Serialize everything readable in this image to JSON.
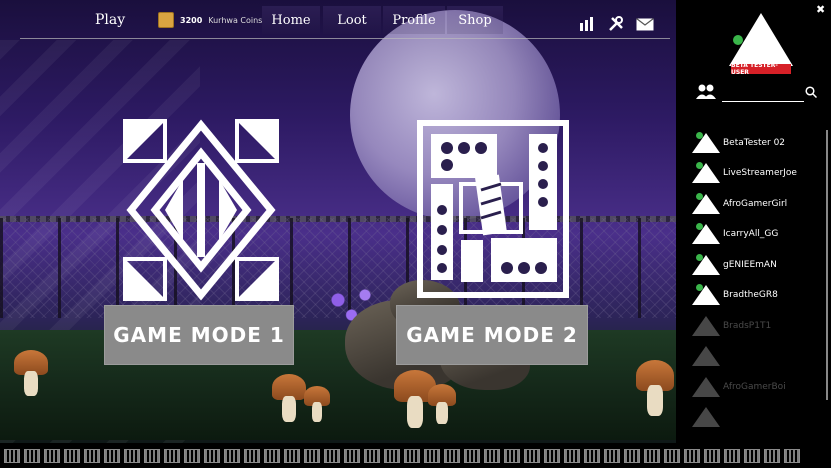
{
  "topbar": {
    "play_label": "Play",
    "coins_amount": "3200",
    "coins_unit": "Kurhwa Coins",
    "tabs": [
      {
        "label": "Home"
      },
      {
        "label": "Loot"
      },
      {
        "label": "Profile"
      },
      {
        "label": "Shop"
      }
    ],
    "icons": [
      "leaderboard-icon",
      "settings-icon",
      "mail-icon"
    ]
  },
  "modes": [
    {
      "label": "GAME MODE 1",
      "icon": "game-mode-1-emblem"
    },
    {
      "label": "GAME MODE 2",
      "icon": "game-mode-2-emblem"
    }
  ],
  "sidebar": {
    "badge": "BETA TESTER-USER",
    "friends": [
      {
        "name": "BetaTester 02",
        "online": true
      },
      {
        "name": "LiveStreamerJoe",
        "online": true
      },
      {
        "name": "AfroGamerGirl",
        "online": true
      },
      {
        "name": "IcarryAll_GG",
        "online": true
      },
      {
        "name": "gENIEEmAN",
        "online": true
      },
      {
        "name": "BradtheGR8",
        "online": true
      },
      {
        "name": "BradsP1T1",
        "online": false
      },
      {
        "name": "",
        "online": false
      },
      {
        "name": "AfroGamerBoi",
        "online": false
      },
      {
        "name": "",
        "online": false
      }
    ]
  },
  "colors": {
    "badge": "#d62027",
    "online": "#3ab54a",
    "mode_button": "#8a8a8a"
  }
}
